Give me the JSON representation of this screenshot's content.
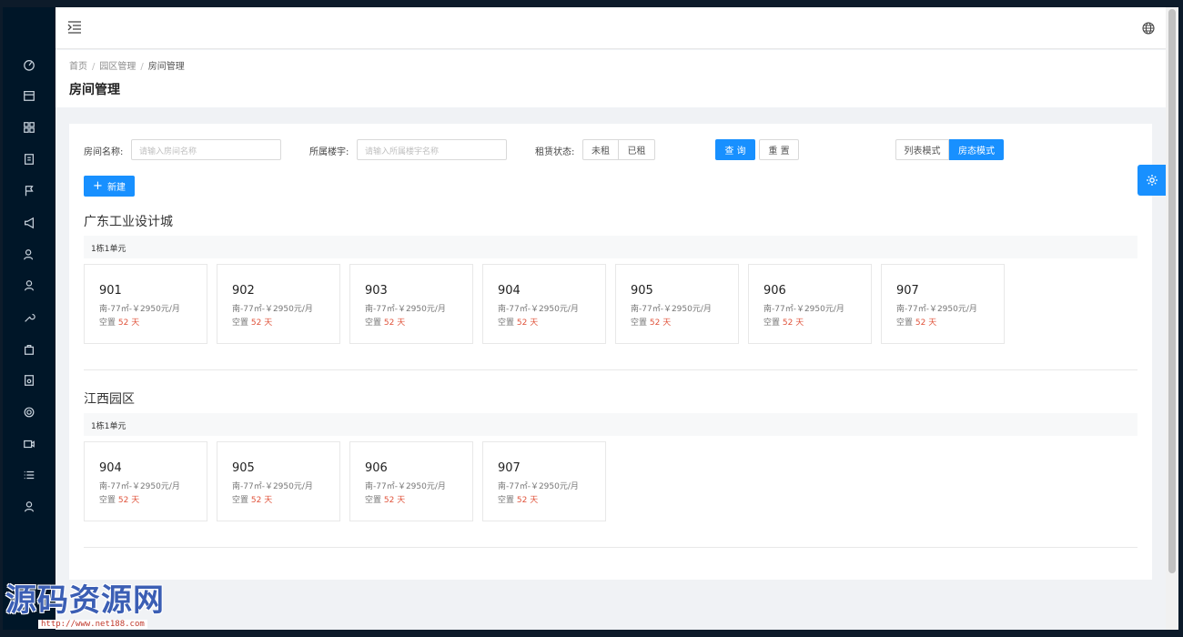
{
  "breadcrumb": [
    "首页",
    "园区管理",
    "房间管理"
  ],
  "page_title": "房间管理",
  "filters": {
    "room_name_label": "房间名称:",
    "room_name_placeholder": "请输入房间名称",
    "building_label": "所属楼宇:",
    "building_placeholder": "请输入所属楼宇名称",
    "rent_status_label": "租赁状态:",
    "rent_status_options": [
      "未租",
      "已租"
    ]
  },
  "buttons": {
    "query": "查 询",
    "reset": "重 置",
    "list_mode": "列表模式",
    "room_state_mode": "房态模式",
    "new": "新建"
  },
  "parks": [
    {
      "name": "广东工业设计城",
      "unit": "1栋1单元",
      "rooms": [
        {
          "no": "901",
          "info": "南-77㎡-￥2950元/月",
          "vacant_prefix": "空置",
          "days": "52 天"
        },
        {
          "no": "902",
          "info": "南-77㎡-￥2950元/月",
          "vacant_prefix": "空置",
          "days": "52 天"
        },
        {
          "no": "903",
          "info": "南-77㎡-￥2950元/月",
          "vacant_prefix": "空置",
          "days": "52 天"
        },
        {
          "no": "904",
          "info": "南-77㎡-￥2950元/月",
          "vacant_prefix": "空置",
          "days": "52 天"
        },
        {
          "no": "905",
          "info": "南-77㎡-￥2950元/月",
          "vacant_prefix": "空置",
          "days": "52 天"
        },
        {
          "no": "906",
          "info": "南-77㎡-￥2950元/月",
          "vacant_prefix": "空置",
          "days": "52 天"
        },
        {
          "no": "907",
          "info": "南-77㎡-￥2950元/月",
          "vacant_prefix": "空置",
          "days": "52 天"
        }
      ]
    },
    {
      "name": "江西园区",
      "unit": "1栋1单元",
      "rooms": [
        {
          "no": "904",
          "info": "南-77㎡-￥2950元/月",
          "vacant_prefix": "空置",
          "days": "52 天"
        },
        {
          "no": "905",
          "info": "南-77㎡-￥2950元/月",
          "vacant_prefix": "空置",
          "days": "52 天"
        },
        {
          "no": "906",
          "info": "南-77㎡-￥2950元/月",
          "vacant_prefix": "空置",
          "days": "52 天"
        },
        {
          "no": "907",
          "info": "南-77㎡-￥2950元/月",
          "vacant_prefix": "空置",
          "days": "52 天"
        }
      ]
    }
  ],
  "sidebar_icons": [
    "dashboard-icon",
    "store-icon",
    "apps-icon",
    "document-icon",
    "flag-icon",
    "megaphone-icon",
    "user-group-icon",
    "user-icon",
    "wrench-icon",
    "bag-icon",
    "report-icon",
    "settings-icon",
    "video-icon",
    "list-icon",
    "person-icon"
  ],
  "watermark": {
    "text": "源码资源网",
    "url": "http://www.net188.com"
  },
  "colors": {
    "primary": "#1890ff",
    "sidebar": "#001628",
    "vacant_days": "#e0543c"
  }
}
